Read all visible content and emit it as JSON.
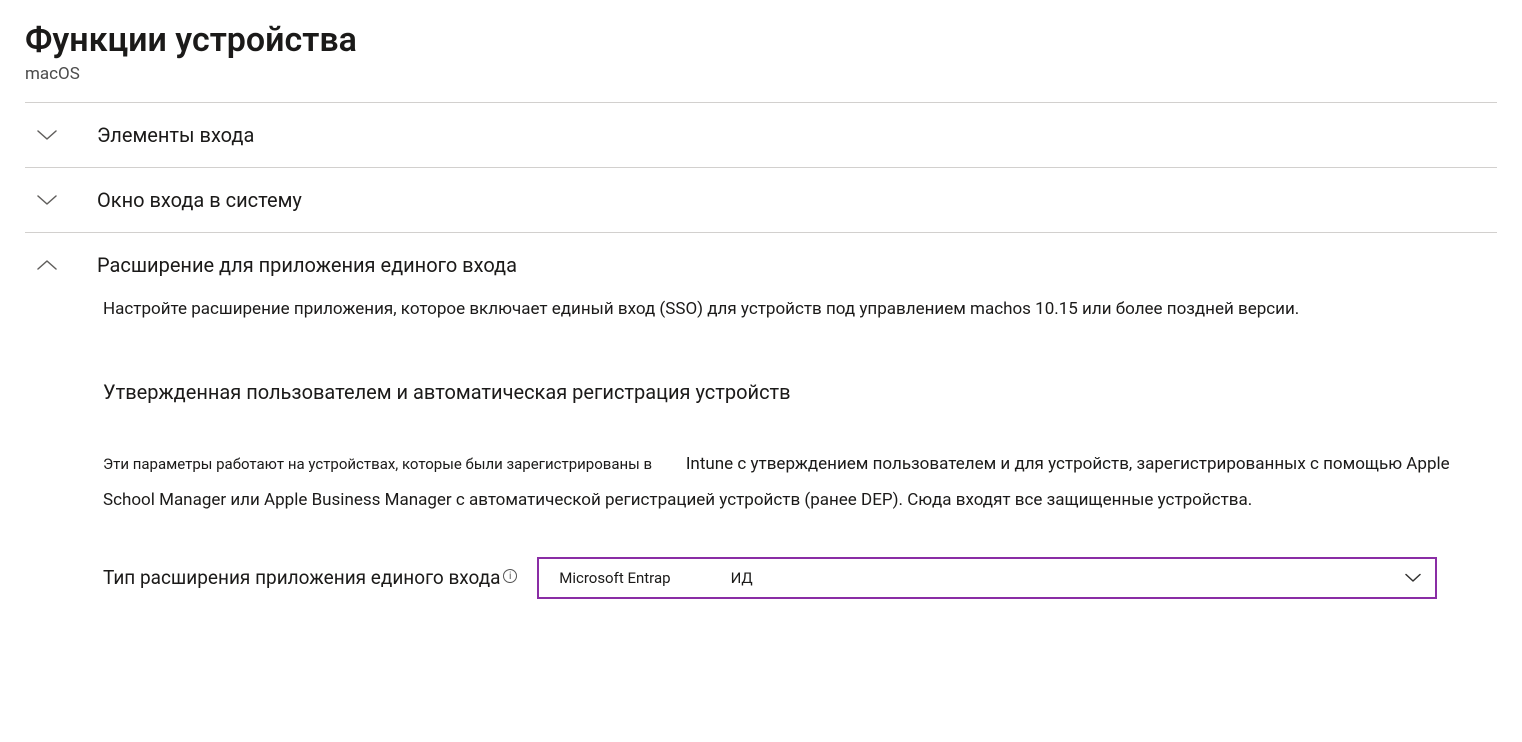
{
  "header": {
    "title": "Функции устройства",
    "subtitle": "macOS"
  },
  "sections": {
    "login_items": {
      "title": "Элементы входа"
    },
    "login_window": {
      "title": "Окно входа в систему"
    },
    "sso_extension": {
      "title": "Расширение для приложения единого входа",
      "description": "Настройте расширение приложения, которое включает единый вход (SSO) для устройств под управлением machos 10.15 или более поздней версии.",
      "subheading": "Утвержденная пользователем и автоматическая регистрация устройств",
      "paragraph_lead": "Эти параметры работают на устройствах, которые были зарегистрированы в",
      "paragraph_rest": "Intune с утверждением пользователем и для устройств, зарегистрированных с помощью Apple School Manager или Apple Business Manager с автоматической регистрацией устройств (ранее DEP). Сюда входят все защищенные устройства.",
      "field": {
        "label": "Тип расширения приложения единого входа",
        "dropdown_value_a": "Microsoft Entraр",
        "dropdown_value_b": "ИД"
      }
    }
  }
}
